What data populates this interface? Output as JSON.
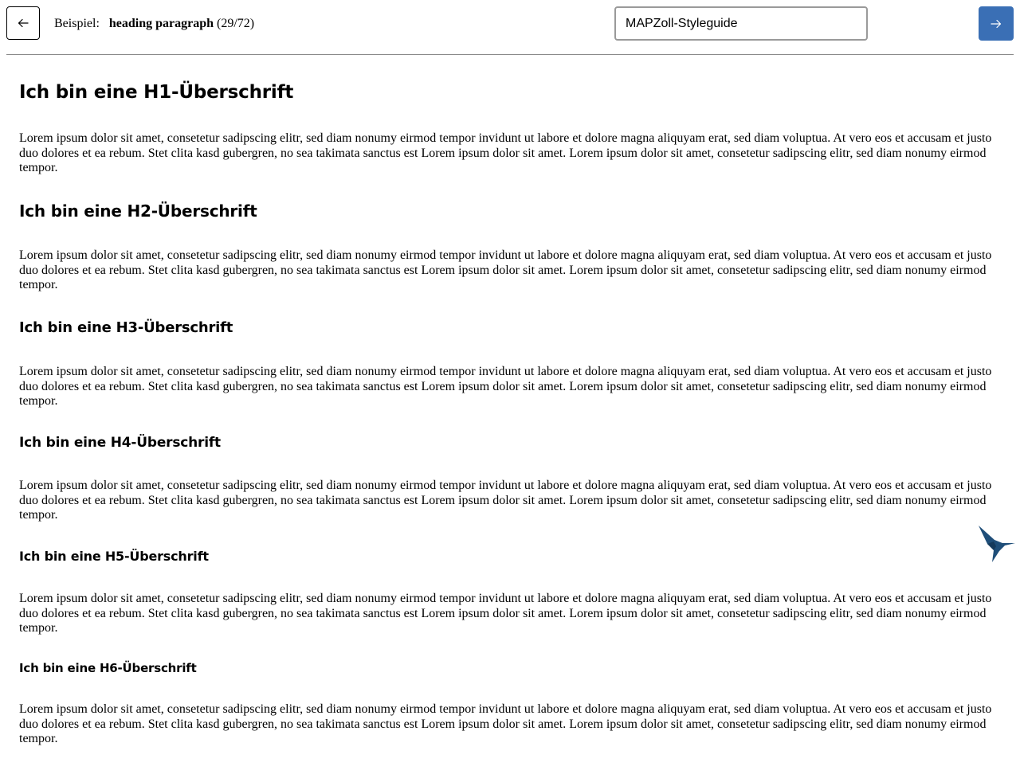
{
  "header": {
    "example_label": "Beispiel:",
    "example_name": "heading paragraph",
    "example_count": "(29/72)",
    "search_value": "MAPZoll-Styleguide",
    "back_icon": "arrow-left-icon",
    "next_icon": "arrow-right-icon"
  },
  "content": {
    "h1": "Ich bin eine H1-Überschrift",
    "h2": "Ich bin eine H2-Überschrift",
    "h3": "Ich bin eine H3-Überschrift",
    "h4": "Ich bin eine H4-Überschrift",
    "h5": "Ich bin eine H5-Überschrift",
    "h6": "Ich bin eine H6-Überschrift",
    "paragraph": "Lorem ipsum dolor sit amet, consetetur sadipscing elitr, sed diam nonumy eirmod tempor invidunt ut labore et dolore magna aliquyam erat, sed diam voluptua. At vero eos et accusam et justo duo dolores et ea rebum. Stet clita kasd gubergren, no sea takimata sanctus est Lorem ipsum dolor sit amet. Lorem ipsum dolor sit amet, consetetur sadipscing elitr, sed diam nonumy eirmod tempor."
  },
  "colors": {
    "accent": "#3a6fb5",
    "bird": "#1f4e79"
  },
  "icons": {
    "logo": "hummingbird-icon"
  }
}
